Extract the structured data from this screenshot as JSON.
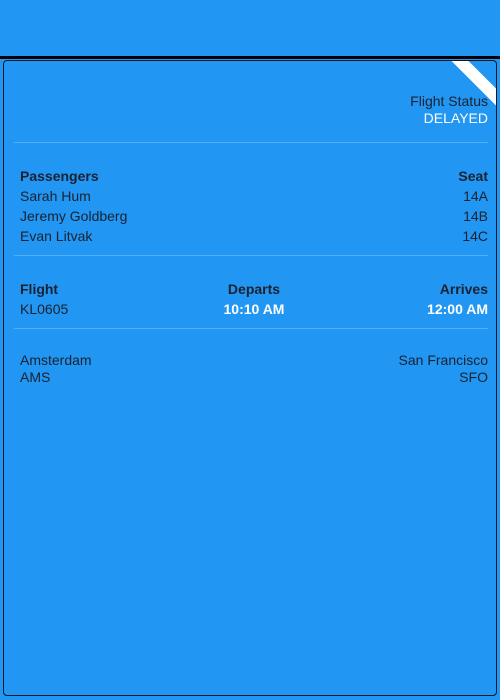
{
  "status": {
    "label": "Flight Status",
    "value": "DELAYED"
  },
  "passengers": {
    "header_label": "Passengers",
    "seat_header": "Seat",
    "list": [
      {
        "name": "Sarah Hum",
        "seat": "14A"
      },
      {
        "name": "Jeremy Goldberg",
        "seat": "14B"
      },
      {
        "name": "Evan Litvak",
        "seat": "14C"
      }
    ]
  },
  "flight": {
    "label": "Flight",
    "number": "KL0605",
    "departs_label": "Departs",
    "departs_time": "10:10 AM",
    "arrives_label": "Arrives",
    "arrives_time": "12:00 AM"
  },
  "route": {
    "origin_city": "Amsterdam",
    "origin_code": "AMS",
    "destination_city": "San Francisco",
    "destination_code": "SFO"
  },
  "colors": {
    "background": "#2196f3",
    "ribbon_stripe": "#8b1e2e",
    "highlight_text": "#ffffff"
  }
}
